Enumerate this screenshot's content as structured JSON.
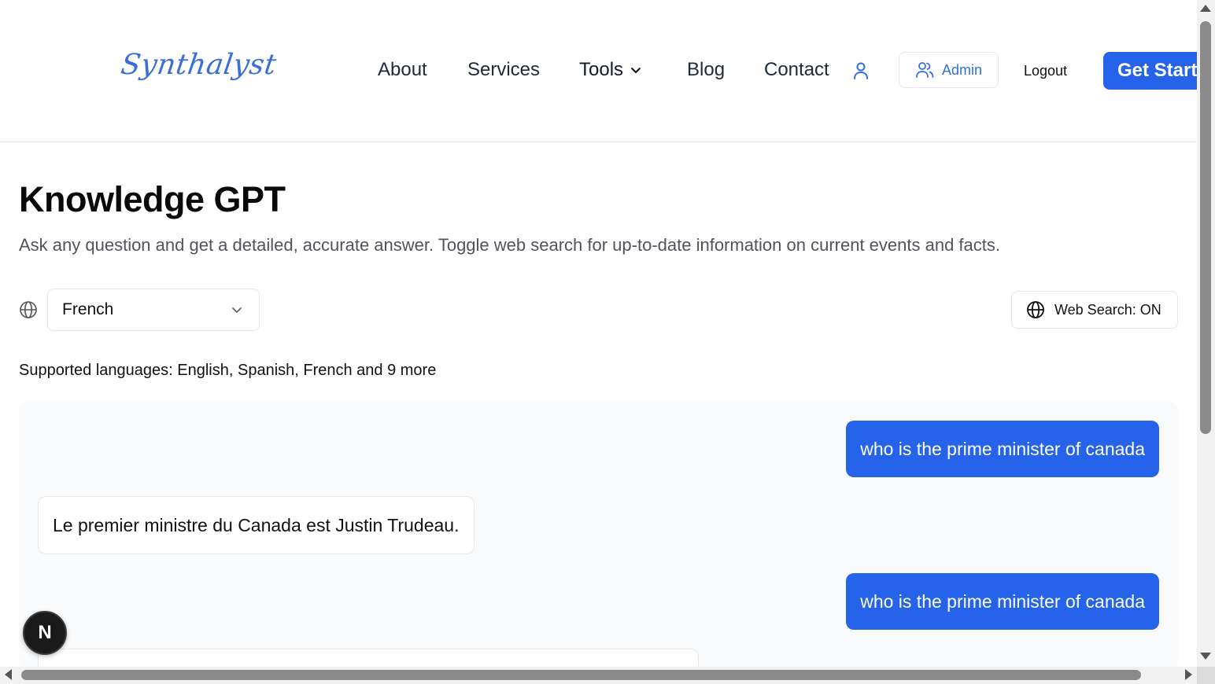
{
  "header": {
    "logo": "Synthalyst",
    "nav": {
      "about": "About",
      "services": "Services",
      "tools": "Tools",
      "blog": "Blog",
      "contact": "Contact"
    },
    "admin_label": "Admin",
    "logout_label": "Logout",
    "cta_label": "Get Started"
  },
  "main": {
    "title": "Knowledge GPT",
    "subtitle": "Ask any question and get a detailed, accurate answer. Toggle web search for up-to-date information on current events and facts.",
    "language_select": {
      "selected": "French",
      "icon": "globe-icon"
    },
    "web_search_label": "Web Search: ON",
    "supported_languages": "Supported languages: English, Spanish, French and 9 more"
  },
  "chat": {
    "messages": [
      {
        "role": "user",
        "text": "who is the prime minister of canada"
      },
      {
        "role": "assistant",
        "text": "Le premier ministre du Canada est Justin Trudeau."
      },
      {
        "role": "user",
        "text": "who is the prime minister of canada"
      },
      {
        "role": "assistant",
        "text": ""
      }
    ]
  },
  "badge": {
    "label": "N"
  },
  "colors": {
    "accent": "#2563eb",
    "logo": "#3b6fd6",
    "chat_bg": "#f8fafc"
  }
}
